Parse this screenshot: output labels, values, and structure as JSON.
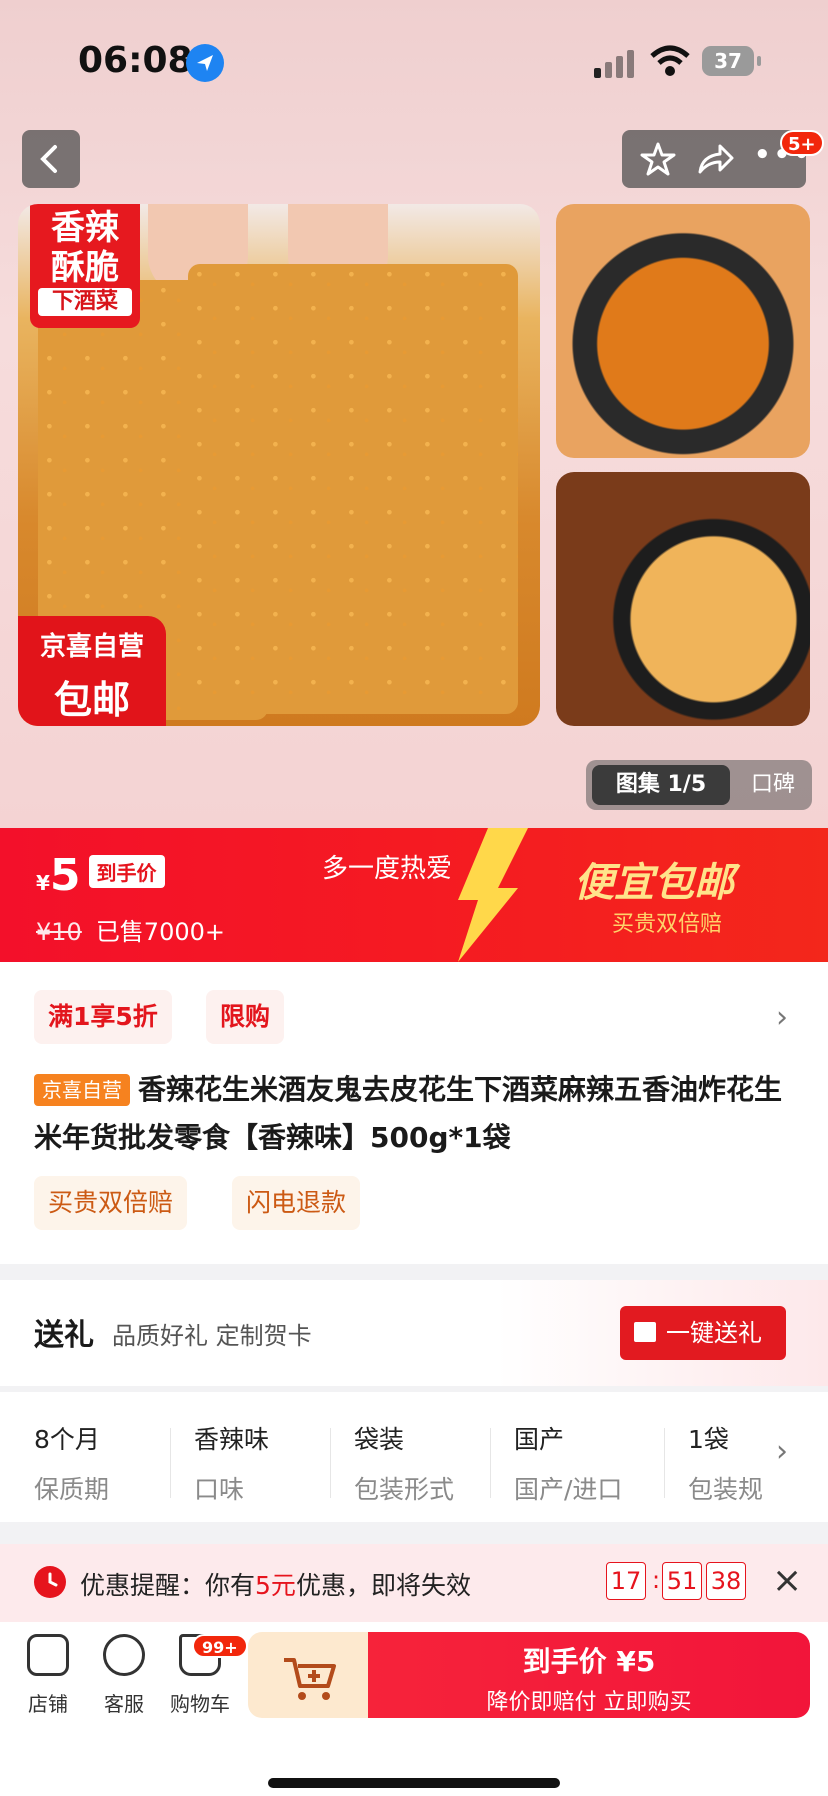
{
  "status_bar": {
    "time": "06:08",
    "battery": "37"
  },
  "top_bar": {
    "notification_badge": "5+"
  },
  "hero": {
    "main_image": {
      "tag_top_line1": "香辣",
      "tag_top_line2": "酥脆",
      "tag_top_line3": "下酒菜",
      "tag_bottom_line1": "京喜自营",
      "tag_bottom_line2": "包邮"
    },
    "gallery": {
      "label": "图集 1/5",
      "reviews": "口碑"
    }
  },
  "price_banner": {
    "currency": "¥",
    "price": "5",
    "price_tag": "到手价",
    "original_price": "¥10",
    "sold": "已售7000+",
    "slogan": "多一度热爱",
    "right_title": "便宜包邮",
    "right_sub": "买贵双倍赔"
  },
  "info": {
    "chips": [
      "满1享5折",
      "限购"
    ],
    "store_tag": "京喜自营",
    "title": "香辣花生米酒友鬼去皮花生下酒菜麻辣五香油炸花生米年货批发零食【香辣味】500g*1袋",
    "service_chips": [
      "买贵双倍赔",
      "闪电退款"
    ]
  },
  "gift": {
    "title": "送礼",
    "subtitle": "品质好礼 定制贺卡",
    "button": "一键送礼"
  },
  "specs": [
    {
      "value": "8个月",
      "key": "保质期"
    },
    {
      "value": "香辣味",
      "key": "口味"
    },
    {
      "value": "袋装",
      "key": "包装形式"
    },
    {
      "value": "国产",
      "key": "国产/进口"
    },
    {
      "value": "1袋",
      "key": "包装规"
    }
  ],
  "promo": {
    "label": "优惠提醒：",
    "text_before": "你有",
    "amount": "5元",
    "text_after": "优惠，即将失效",
    "countdown": [
      "17",
      "51",
      "38"
    ]
  },
  "bottom_bar": {
    "shop": "店铺",
    "service": "客服",
    "cart": "购物车",
    "cart_badge": "99+",
    "buy_title": "到手价 ¥5",
    "buy_sub": "降价即赔付 立即购买"
  },
  "colors": {
    "brand_red": "#e6141d",
    "accent_orange": "#f6821f"
  }
}
